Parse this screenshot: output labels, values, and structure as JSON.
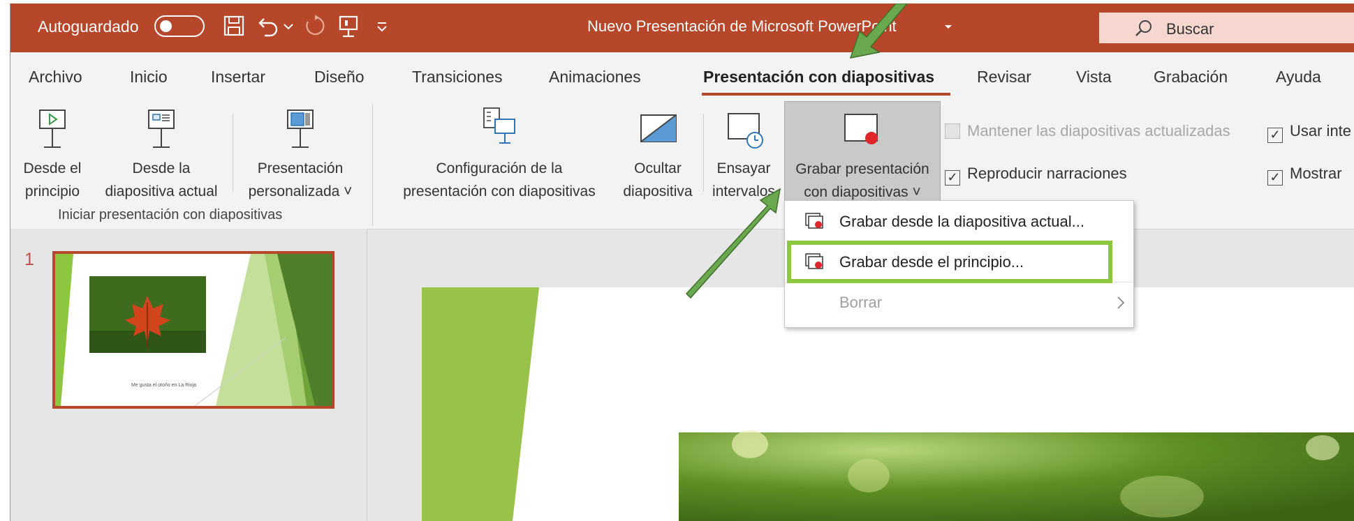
{
  "titlebar": {
    "autosave_label": "Autoguardado",
    "document_title": "Nuevo Presentación de Microsoft PowerPoint",
    "search_label": "Buscar"
  },
  "tabs": [
    "Archivo",
    "Inicio",
    "Insertar",
    "Diseño",
    "Transiciones",
    "Animaciones",
    "Presentación con diapositivas",
    "Revisar",
    "Vista",
    "Grabación",
    "Ayuda"
  ],
  "active_tab": "Presentación con diapositivas",
  "ribbon": {
    "from_start": [
      "Desde el",
      "principio"
    ],
    "from_current": [
      "Desde la",
      "diapositiva actual"
    ],
    "custom": [
      "Presentación",
      "personalizada ˅"
    ],
    "start_group_label": "Iniciar presentación con diapositivas",
    "setup": [
      "Configuración de la",
      "presentación con diapositivas"
    ],
    "hide": [
      "Ocultar",
      "diapositiva"
    ],
    "rehearse": [
      "Ensayar",
      "intervalos"
    ],
    "record": [
      "Grabar presentación",
      "con diapositivas ˅"
    ],
    "keep_updated": "Mantener las diapositivas actualizadas",
    "play_narrations": "Reproducir narraciones",
    "use_timings": "Usar inte",
    "show_media": "Mostrar"
  },
  "dropdown": {
    "items": [
      {
        "label": "Grabar desde la diapositiva actual...",
        "enabled": true
      },
      {
        "label": "Grabar desde el principio...",
        "enabled": true
      },
      {
        "label": "Borrar",
        "enabled": false
      }
    ]
  },
  "slides_panel": {
    "slide_number": "1",
    "caption": "Me gusta el otoño en La Rioja"
  },
  "colors": {
    "accent": "#b7472a",
    "highlight": "#8dc63f",
    "arrow": "#6aa84f"
  }
}
